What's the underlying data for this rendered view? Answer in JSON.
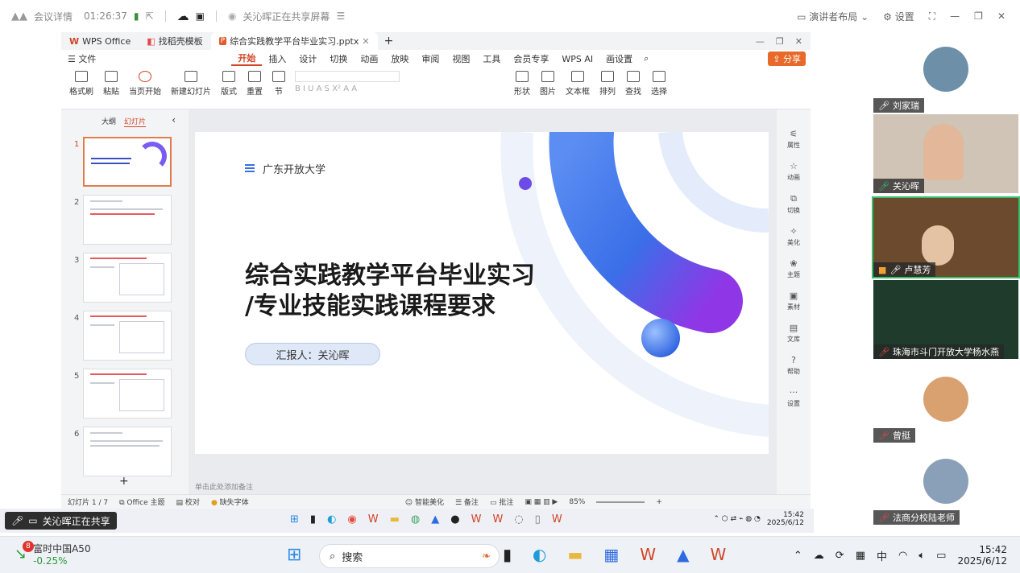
{
  "meeting": {
    "details_label": "会议详情",
    "elapsed": "01:26:37",
    "sharing_notice": "关沁晖正在共享屏幕",
    "presenter_layout": "演讲者布局",
    "settings_label": "设置"
  },
  "wps": {
    "tabs": [
      {
        "label": "WPS Office"
      },
      {
        "label": "找稻壳模板"
      },
      {
        "label": "综合实践教学平台毕业实习.pptx"
      }
    ],
    "file_menu": "文件",
    "menus": [
      "开始",
      "插入",
      "设计",
      "切换",
      "动画",
      "放映",
      "审阅",
      "视图",
      "工具",
      "会员专享",
      "WPS AI",
      "画设置"
    ],
    "share_label": "分享",
    "ribbon": {
      "format_brush": "格式刷",
      "paste": "粘贴",
      "play_from_current": "当页开始",
      "new_slide": "新建幻灯片",
      "layout": "版式",
      "section": "节",
      "reset": "重置",
      "shape": "形状",
      "picture": "图片",
      "textbox": "文本框",
      "arrange": "排列",
      "find": "查找",
      "select": "选择"
    },
    "pane_tabs": [
      "大纲",
      "幻灯片"
    ],
    "thumb_numbers": [
      "1",
      "2",
      "3",
      "4",
      "5",
      "6"
    ],
    "side_tools": [
      "属性",
      "动画",
      "切换",
      "美化",
      "主题",
      "素材",
      "文库",
      "帮助",
      "设置"
    ],
    "notes_placeholder": "单击此处添加备注",
    "status": {
      "slide_pos": "幻灯片 1 / 7",
      "theme": "Office 主题",
      "proof": "校对",
      "missing_font": "缺失字体",
      "smart": "智能美化",
      "notes": "备注",
      "comments": "批注",
      "zoom": "85%"
    }
  },
  "slide": {
    "org": "广东开放大学",
    "title": "综合实践教学平台毕业实习\n/专业技能实践课程要求",
    "reporter": "汇报人：关沁晖"
  },
  "remote_taskbar": {
    "share_label": "关沁晖正在共享",
    "time": "15:42",
    "date": "2025/6/12"
  },
  "participants": [
    {
      "name": "刘家瑞"
    },
    {
      "name": "关沁晖"
    },
    {
      "name": "卢慧芳"
    },
    {
      "name": "珠海市斗门开放大学杨水燕"
    },
    {
      "name": "曾挺"
    },
    {
      "name": "法商分校陆老师"
    }
  ],
  "taskbar": {
    "stock_badge": "8",
    "stock_name": "富时中国A50",
    "stock_change": "-0.25%",
    "search_placeholder": "搜索",
    "ime": "中",
    "time": "15:42",
    "date": "2025/6/12"
  },
  "colors": {
    "accent_red": "#d04526",
    "share_green": "#35c06a",
    "slide_blue": "#3a6fe8",
    "slide_purple": "#8f37e6"
  }
}
